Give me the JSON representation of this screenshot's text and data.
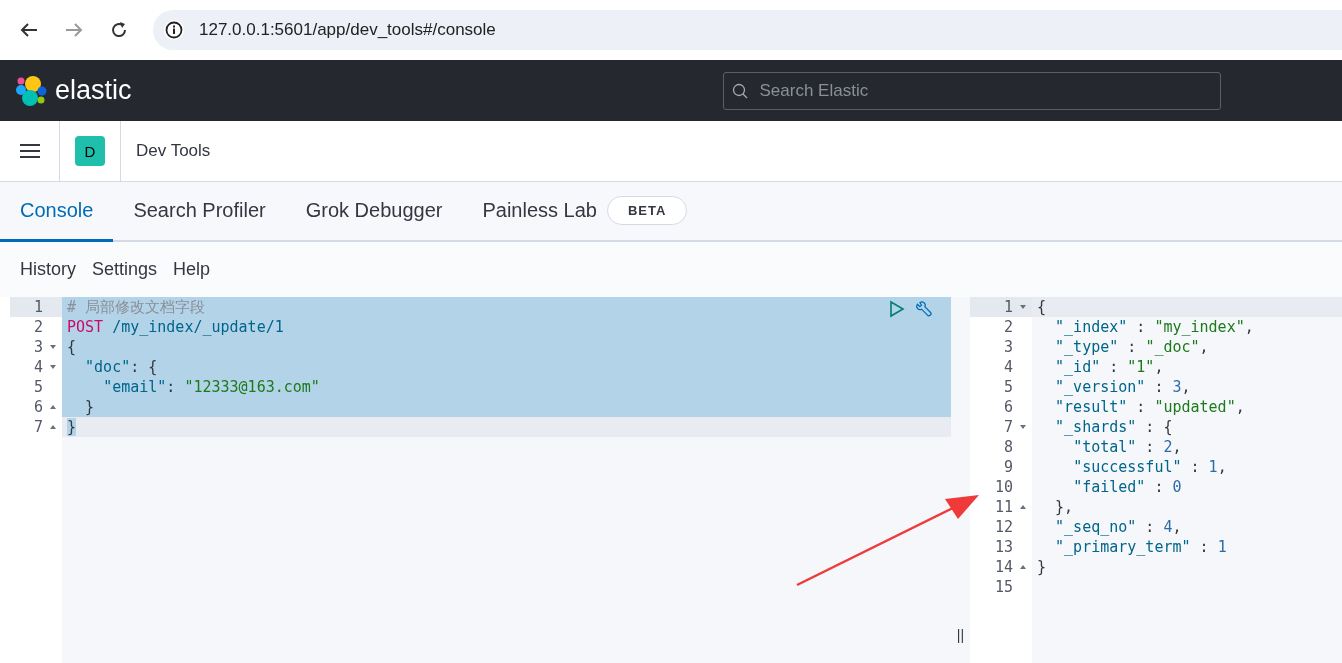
{
  "browser": {
    "url": "127.0.0.1:5601/app/dev_tools#/console"
  },
  "header": {
    "logo_text": "elastic",
    "search": {
      "placeholder": "Search Elastic"
    }
  },
  "breadcrumb": {
    "avatar": "D",
    "title": "Dev Tools"
  },
  "tabs": [
    {
      "label": "Console",
      "selected": true
    },
    {
      "label": "Search Profiler",
      "selected": false
    },
    {
      "label": "Grok Debugger",
      "selected": false
    },
    {
      "label": "Painless Lab",
      "selected": false,
      "badge": "BETA"
    }
  ],
  "menu": [
    "History",
    "Settings",
    "Help"
  ],
  "request": {
    "lines": [
      {
        "number": "1",
        "fold_start": false,
        "fold_end": false,
        "selected": true,
        "current": false,
        "gutter_active": true,
        "text": "# 局部修改文档字段"
      },
      {
        "number": "2",
        "fold_start": false,
        "fold_end": false,
        "selected": true,
        "current": false,
        "gutter_active": false,
        "text": "POST /my_index/_update/1"
      },
      {
        "number": "3",
        "fold_start": true,
        "fold_end": false,
        "selected": true,
        "current": false,
        "gutter_active": false,
        "text": "{"
      },
      {
        "number": "4",
        "fold_start": true,
        "fold_end": false,
        "selected": true,
        "current": false,
        "gutter_active": false,
        "text": "  \"doc\": {"
      },
      {
        "number": "5",
        "fold_start": false,
        "fold_end": false,
        "selected": true,
        "current": false,
        "gutter_active": false,
        "text": "    \"email\": \"12333@163.com\""
      },
      {
        "number": "6",
        "fold_start": false,
        "fold_end": true,
        "selected": true,
        "current": false,
        "gutter_active": false,
        "text": "  }"
      },
      {
        "number": "7",
        "fold_start": false,
        "fold_end": true,
        "selected": true,
        "current": true,
        "gutter_active": false,
        "text": "}"
      }
    ]
  },
  "response": {
    "lines": [
      {
        "number": "1",
        "fold_start": true,
        "fold_end": false,
        "current": true,
        "text": "{"
      },
      {
        "number": "2",
        "fold_start": false,
        "fold_end": false,
        "current": false,
        "text": "  \"_index\" : \"my_index\","
      },
      {
        "number": "3",
        "fold_start": false,
        "fold_end": false,
        "current": false,
        "text": "  \"_type\" : \"_doc\","
      },
      {
        "number": "4",
        "fold_start": false,
        "fold_end": false,
        "current": false,
        "text": "  \"_id\" : \"1\","
      },
      {
        "number": "5",
        "fold_start": false,
        "fold_end": false,
        "current": false,
        "text": "  \"_version\" : 3,"
      },
      {
        "number": "6",
        "fold_start": false,
        "fold_end": false,
        "current": false,
        "text": "  \"result\" : \"updated\","
      },
      {
        "number": "7",
        "fold_start": true,
        "fold_end": false,
        "current": false,
        "text": "  \"_shards\" : {"
      },
      {
        "number": "8",
        "fold_start": false,
        "fold_end": false,
        "current": false,
        "text": "    \"total\" : 2,"
      },
      {
        "number": "9",
        "fold_start": false,
        "fold_end": false,
        "current": false,
        "text": "    \"successful\" : 1,"
      },
      {
        "number": "10",
        "fold_start": false,
        "fold_end": false,
        "current": false,
        "text": "    \"failed\" : 0"
      },
      {
        "number": "11",
        "fold_start": false,
        "fold_end": true,
        "current": false,
        "text": "  },"
      },
      {
        "number": "12",
        "fold_start": false,
        "fold_end": false,
        "current": false,
        "text": "  \"_seq_no\" : 4,"
      },
      {
        "number": "13",
        "fold_start": false,
        "fold_end": false,
        "current": false,
        "text": "  \"_primary_term\" : 1"
      },
      {
        "number": "14",
        "fold_start": false,
        "fold_end": true,
        "current": false,
        "text": "}"
      },
      {
        "number": "15",
        "fold_start": false,
        "fold_end": false,
        "current": false
      }
    ]
  },
  "resizer": {
    "handle": "||"
  }
}
